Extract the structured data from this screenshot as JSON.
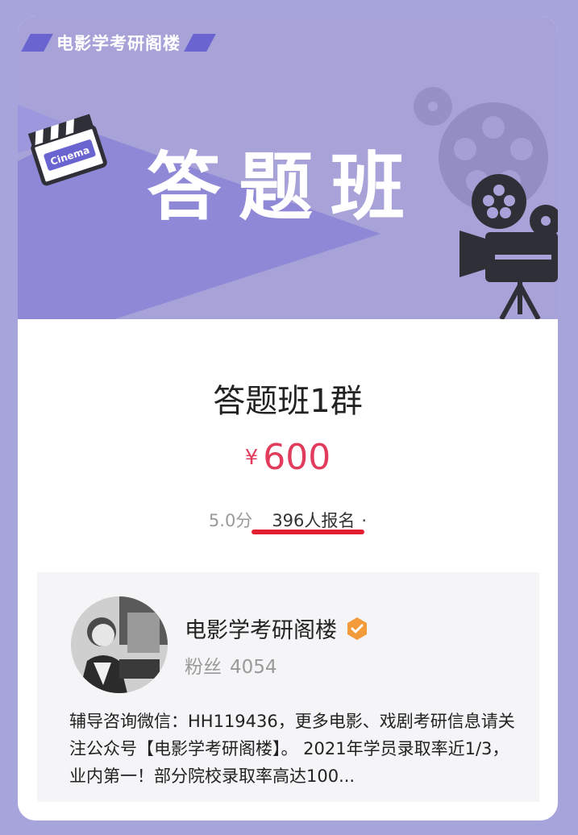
{
  "banner": {
    "brand": "电影学考研阁楼",
    "title": "答题班",
    "clapper_text": "Cinema"
  },
  "course": {
    "title": "答题班1群",
    "currency": "¥",
    "price": "600",
    "rating": "5.0分",
    "enrolled": "396人报名",
    "dot": "·"
  },
  "author": {
    "name": "电影学考研阁楼",
    "fans_label": "粉丝",
    "fans_count": "4054",
    "description": "辅导咨询微信：HH119436，更多电影、戏剧考研信息请关注公众号【电影学考研阁楼】。 2021年学员录取率近1/3，业内第一！部分院校录取率高达100..."
  },
  "colors": {
    "page_background": "#a7a4dc",
    "banner_background": "#a7a2d8",
    "price": "#e13c5c",
    "underline": "#e2202f",
    "verified_badge": "#f39a3b"
  },
  "icons": {
    "clapperboard": "clapperboard-icon",
    "film_reel": "film-reel-icon",
    "projector": "projector-icon",
    "verified": "verified-badge-icon"
  }
}
